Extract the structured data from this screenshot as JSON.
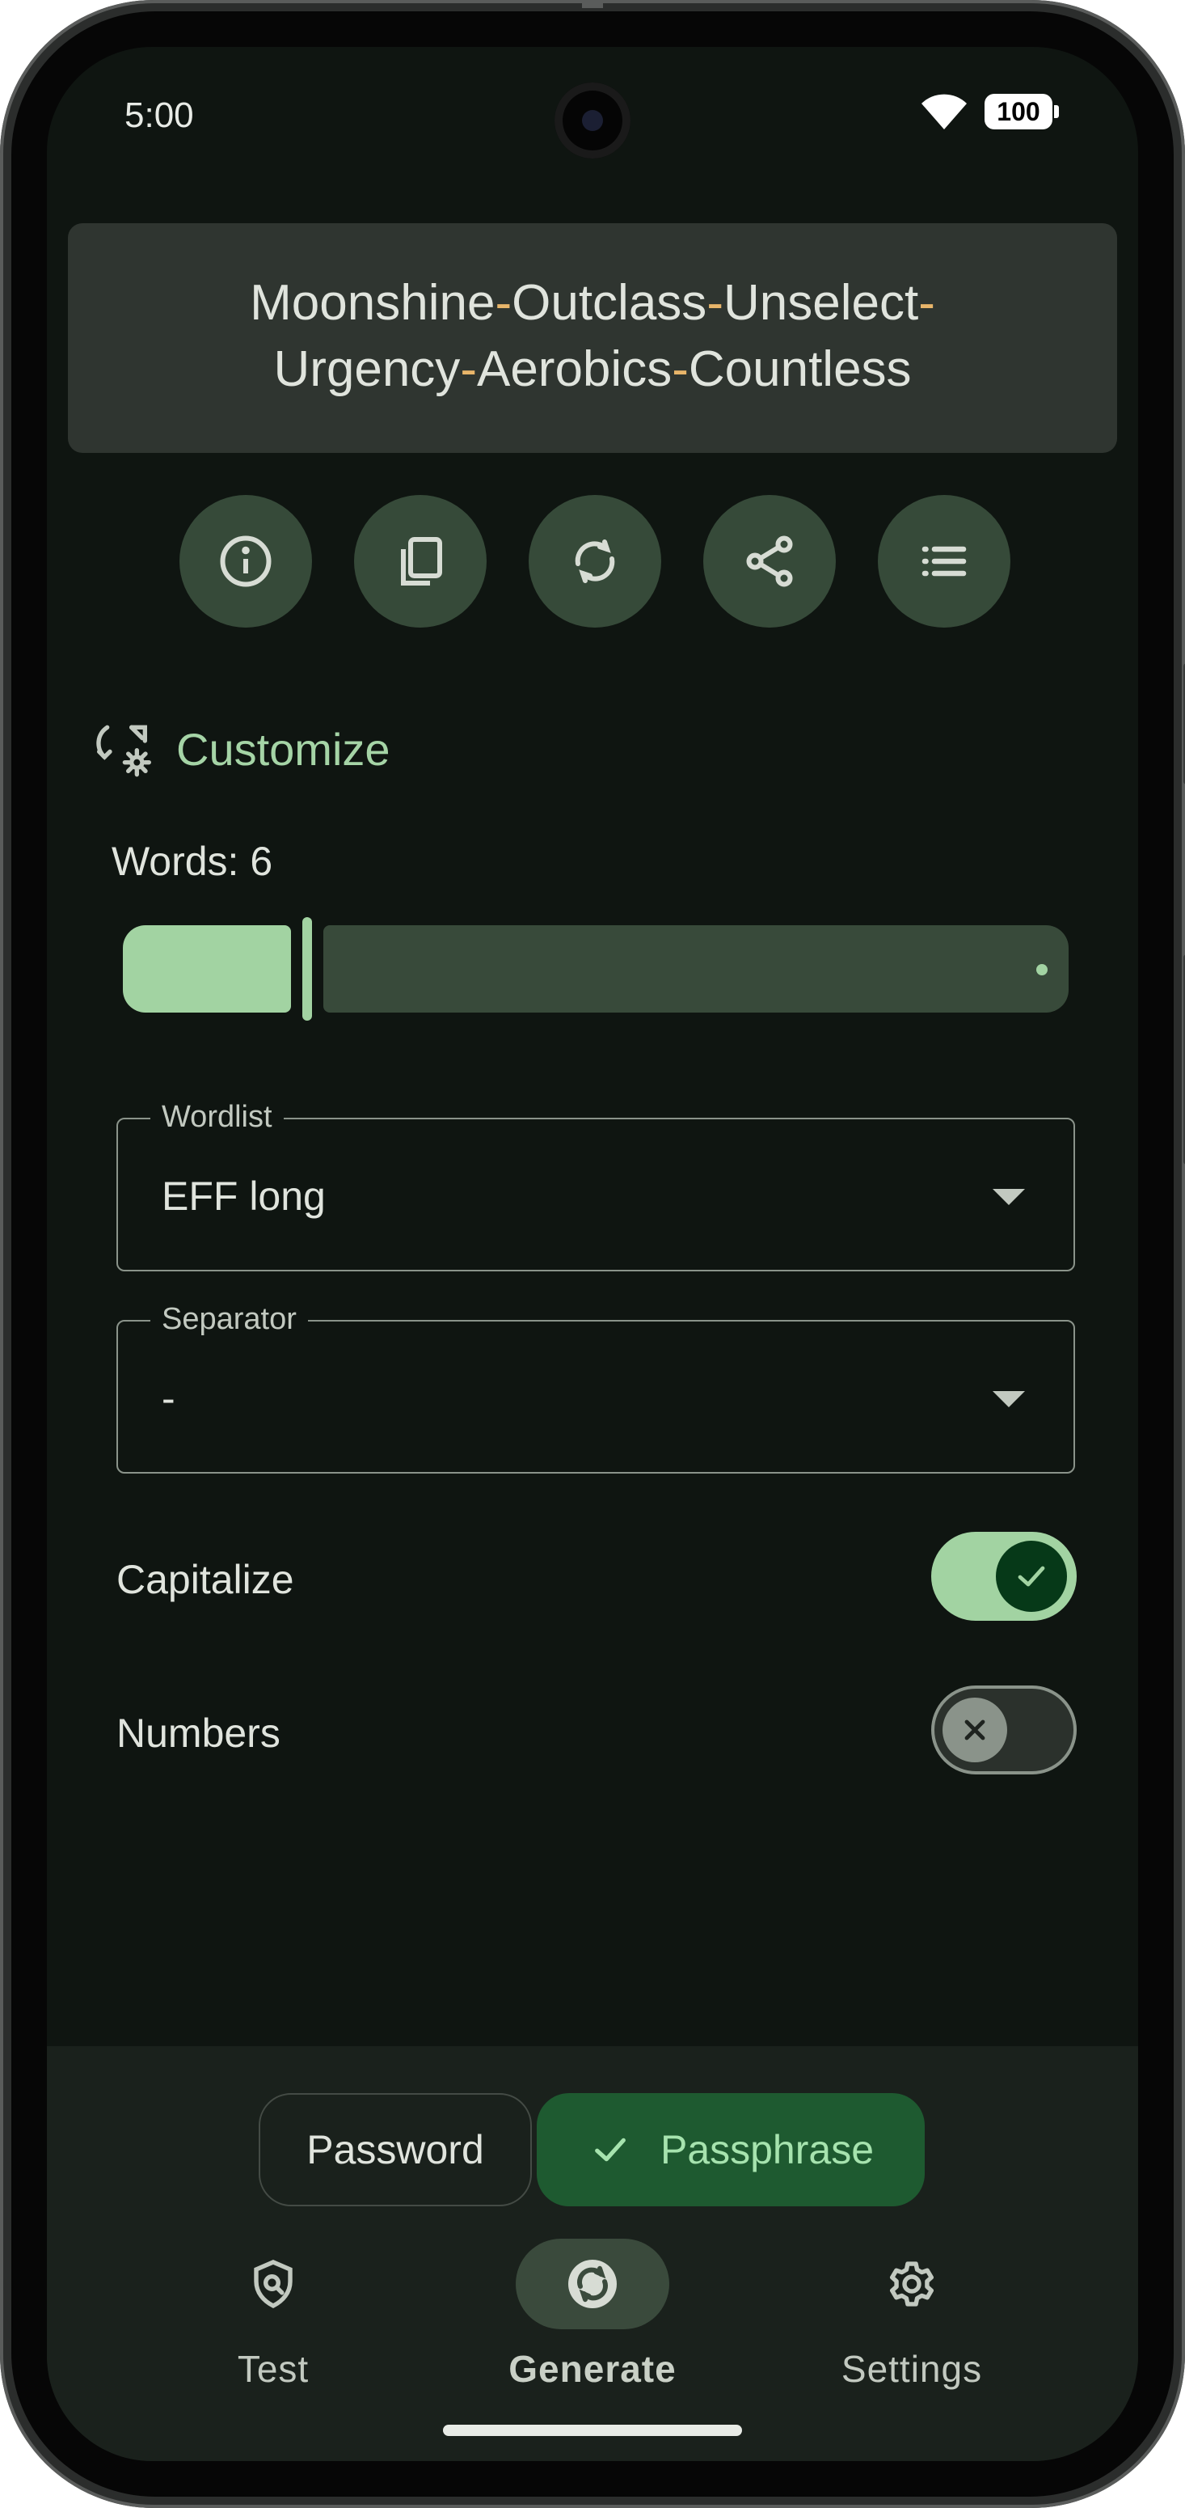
{
  "status_bar": {
    "time": "5:00",
    "battery": "100",
    "icons": [
      "wifi-icon",
      "battery-icon"
    ]
  },
  "passphrase": {
    "words": [
      "Moonshine",
      "Outclass",
      "Unselect",
      "Urgency",
      "Aerobics",
      "Countless"
    ],
    "separator": "-",
    "word_color": "#e0e4dd",
    "separator_color": "#e8b56a"
  },
  "actions": [
    {
      "name": "info-button",
      "icon": "info-icon"
    },
    {
      "name": "copy-button",
      "icon": "copy-icon"
    },
    {
      "name": "regenerate-button",
      "icon": "refresh-icon"
    },
    {
      "name": "share-button",
      "icon": "share-icon"
    },
    {
      "name": "list-button",
      "icon": "list-icon"
    }
  ],
  "customize": {
    "title": "Customize",
    "icon": "customize-icon",
    "words_label": "Words: 6",
    "words_slider_fraction": 0.19,
    "wordlist": {
      "label": "Wordlist",
      "value": "EFF long"
    },
    "separator": {
      "label": "Separator",
      "value": "-"
    },
    "capitalize": {
      "label": "Capitalize",
      "on": true
    },
    "numbers": {
      "label": "Numbers",
      "on": false
    }
  },
  "mode_toggle": {
    "password_label": "Password",
    "passphrase_label": "Passphrase",
    "selected": "passphrase"
  },
  "bottom_nav": {
    "items": [
      {
        "label": "Test",
        "icon": "shield-search-icon",
        "active": false
      },
      {
        "label": "Generate",
        "icon": "generate-icon",
        "active": true
      },
      {
        "label": "Settings",
        "icon": "gear-icon",
        "active": false
      }
    ]
  },
  "colors": {
    "background": "#0f1511",
    "accent": "#a2d3a2",
    "accent_dark": "#1e5a30",
    "surface": "#2f3530"
  }
}
